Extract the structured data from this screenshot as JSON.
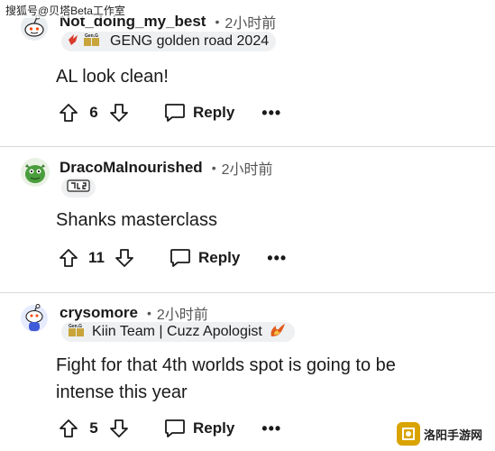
{
  "watermark_top": "搜狐号@贝塔Beta工作室",
  "comments": [
    {
      "username": "Not_doing_my_best",
      "time": "2小时前",
      "flair_text": "GENG golden road 2024",
      "flair_badge": "Gen.G",
      "body_lines": [
        "AL look clean!"
      ],
      "score": "6",
      "reply_label": "Reply",
      "more_label": "•••"
    },
    {
      "username": "DracoMalnourished",
      "time": "2小时前",
      "flair_text": "",
      "body_lines": [
        "Shanks masterclass"
      ],
      "score": "11",
      "reply_label": "Reply",
      "more_label": "•••"
    },
    {
      "username": "crysomore",
      "time": "2小时前",
      "flair_text": "Kiin Team | Cuzz Apologist",
      "flair_badge": "Gen.G",
      "body_lines": [
        "Fight for that 4th worlds spot is going to be",
        "intense this year"
      ],
      "score": "5",
      "reply_label": "Reply",
      "more_label": "•••"
    }
  ],
  "logo_watermark": "洛阳手游网",
  "colors": {
    "text": "#1a1a1b",
    "muted": "#555555",
    "flair_bg": "#eef0f2",
    "gold": "#c8a43a",
    "red": "#d93a2b",
    "green_avatar": "#4a9d3c"
  }
}
